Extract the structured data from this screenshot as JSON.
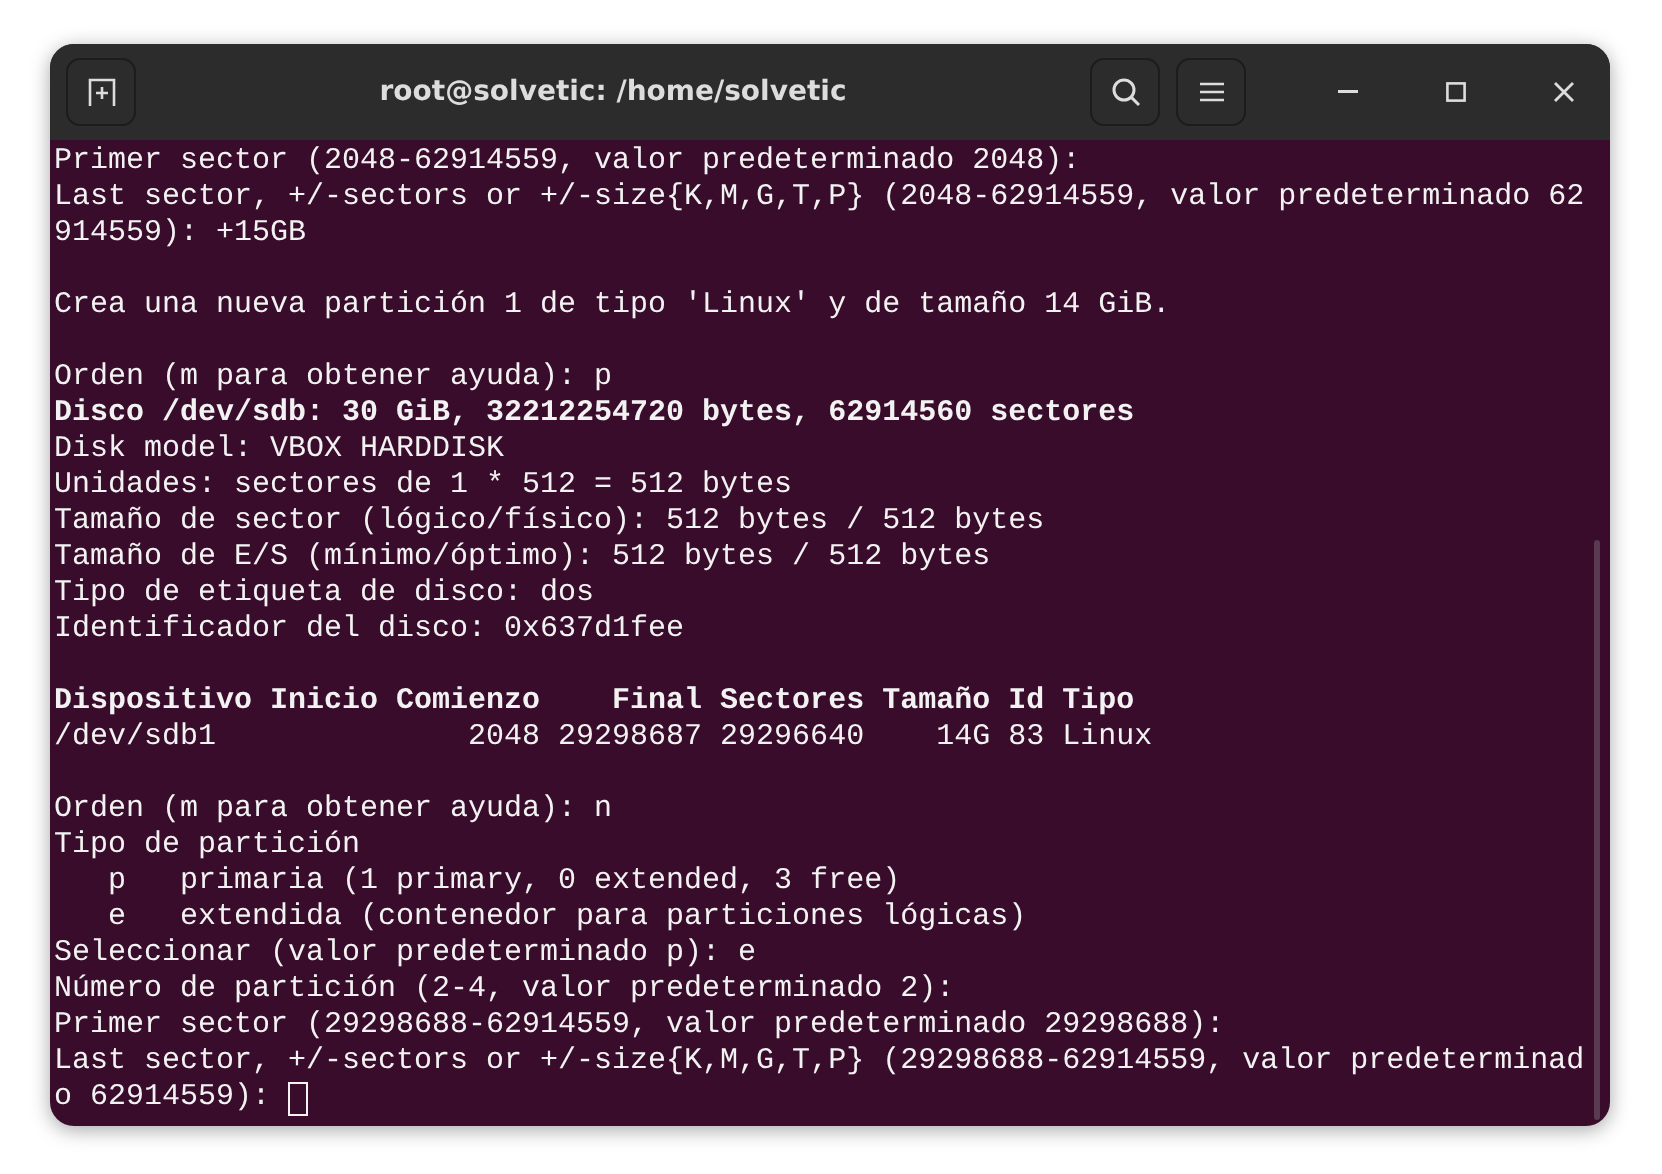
{
  "window": {
    "title": "root@solvetic: /home/solvetic"
  },
  "terminal": {
    "lines": [
      {
        "kind": "text",
        "text": "Primer sector (2048-62914559, valor predeterminado 2048):",
        "bold": false
      },
      {
        "kind": "text",
        "text": "Last sector, +/-sectors or +/-size{K,M,G,T,P} (2048-62914559, valor predeterminado 62",
        "bold": false
      },
      {
        "kind": "text",
        "text": "914559): +15GB",
        "bold": false
      },
      {
        "kind": "blank"
      },
      {
        "kind": "text",
        "text": "Crea una nueva partición 1 de tipo 'Linux' y de tamaño 14 GiB.",
        "bold": false
      },
      {
        "kind": "blank"
      },
      {
        "kind": "text",
        "text": "Orden (m para obtener ayuda): p",
        "bold": false
      },
      {
        "kind": "text",
        "text": "Disco /dev/sdb: 30 GiB, 32212254720 bytes, 62914560 sectores",
        "bold": true
      },
      {
        "kind": "text",
        "text": "Disk model: VBOX HARDDISK",
        "bold": false
      },
      {
        "kind": "text",
        "text": "Unidades: sectores de 1 * 512 = 512 bytes",
        "bold": false
      },
      {
        "kind": "text",
        "text": "Tamaño de sector (lógico/físico): 512 bytes / 512 bytes",
        "bold": false
      },
      {
        "kind": "text",
        "text": "Tamaño de E/S (mínimo/óptimo): 512 bytes / 512 bytes",
        "bold": false
      },
      {
        "kind": "text",
        "text": "Tipo de etiqueta de disco: dos",
        "bold": false
      },
      {
        "kind": "text",
        "text": "Identificador del disco: 0x637d1fee",
        "bold": false
      },
      {
        "kind": "blank"
      },
      {
        "kind": "text",
        "text": "Dispositivo Inicio Comienzo    Final Sectores Tamaño Id Tipo",
        "bold": true
      },
      {
        "kind": "text",
        "text": "/dev/sdb1              2048 29298687 29296640    14G 83 Linux",
        "bold": false
      },
      {
        "kind": "blank"
      },
      {
        "kind": "text",
        "text": "Orden (m para obtener ayuda): n",
        "bold": false
      },
      {
        "kind": "text",
        "text": "Tipo de partición",
        "bold": false
      },
      {
        "kind": "text",
        "text": "   p   primaria (1 primary, 0 extended, 3 free)",
        "bold": false
      },
      {
        "kind": "text",
        "text": "   e   extendida (contenedor para particiones lógicas)",
        "bold": false
      },
      {
        "kind": "text",
        "text": "Seleccionar (valor predeterminado p): e",
        "bold": false
      },
      {
        "kind": "text",
        "text": "Número de partición (2-4, valor predeterminado 2):",
        "bold": false
      },
      {
        "kind": "text",
        "text": "Primer sector (29298688-62914559, valor predeterminado 29298688):",
        "bold": false
      },
      {
        "kind": "text",
        "text": "Last sector, +/-sectors or +/-size{K,M,G,T,P} (29298688-62914559, valor predeterminad",
        "bold": false
      },
      {
        "kind": "prompt",
        "text": "o 62914559): ",
        "bold": false
      }
    ]
  }
}
